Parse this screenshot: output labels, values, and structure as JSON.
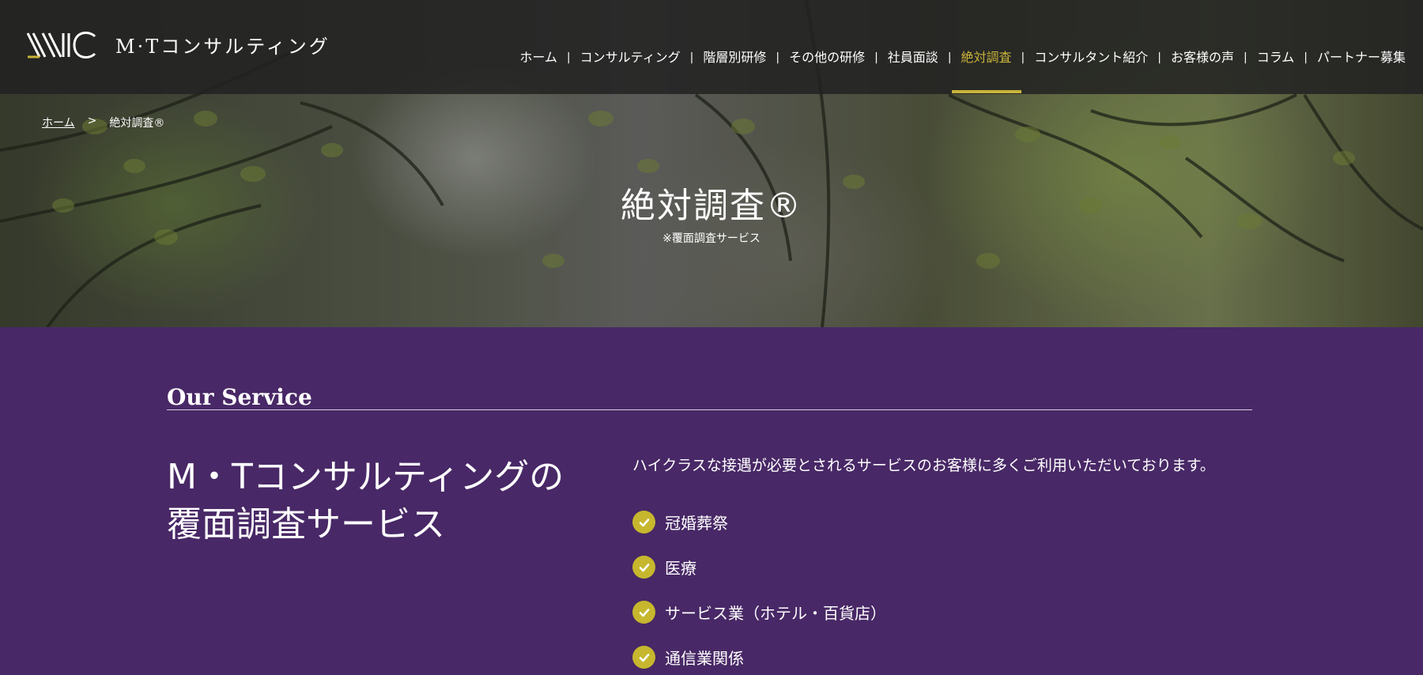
{
  "header": {
    "logo_text": "M·Tコンサルティング",
    "nav": [
      {
        "label": "ホーム",
        "active": false
      },
      {
        "label": "コンサルティング",
        "active": false
      },
      {
        "label": "階層別研修",
        "active": false
      },
      {
        "label": "その他の研修",
        "active": false
      },
      {
        "label": "社員面談",
        "active": false
      },
      {
        "label": "絶対調査",
        "active": true
      },
      {
        "label": "コンサルタント紹介",
        "active": false
      },
      {
        "label": "お客様の声",
        "active": false
      },
      {
        "label": "コラム",
        "active": false
      },
      {
        "label": "パートナー募集",
        "active": false
      }
    ],
    "nav_separator": "|"
  },
  "breadcrumb": {
    "home": "ホーム",
    "separator": ">",
    "current": "絶対調査®"
  },
  "hero": {
    "title": "絶対調査®",
    "subtitle": "※覆面調査サービス"
  },
  "service": {
    "heading": "Our Service",
    "title_line1": "M・Tコンサルティングの",
    "title_line2": "覆面調査サービス",
    "intro": "ハイクラスな接遇が必要とされるサービスのお客様に多くご利用いただいております。",
    "items": [
      "冠婚葬祭",
      "医療",
      "サービス業（ホテル・百貨店）",
      "通信業関係"
    ]
  },
  "colors": {
    "accent": "#c9b43a",
    "section_bg": "#482866",
    "header_bg": "#222222"
  }
}
